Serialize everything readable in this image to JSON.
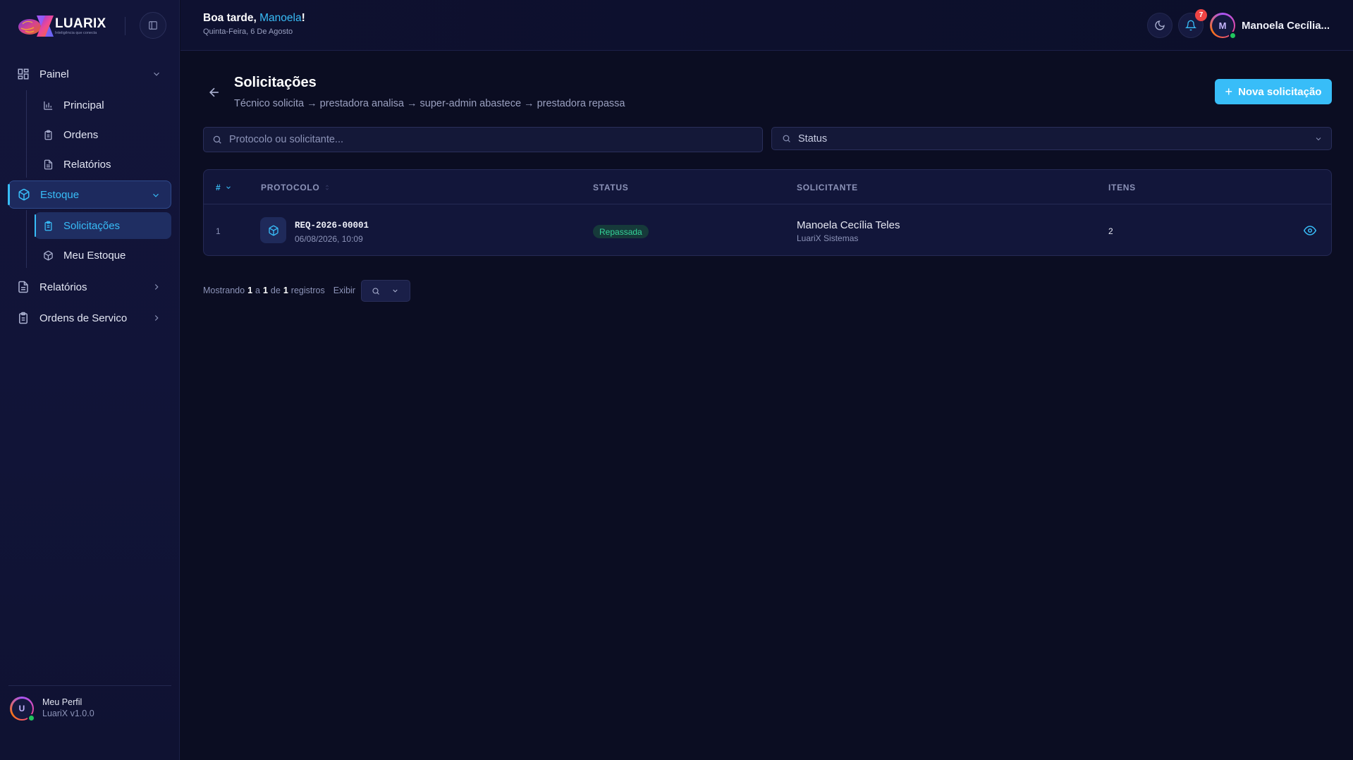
{
  "brand": {
    "name": "LUARIX",
    "tagline": "Inteligência que conecta"
  },
  "sidebar": {
    "items": [
      {
        "label": "Painel",
        "icon": "grid-icon",
        "expanded": true,
        "children": [
          {
            "label": "Principal",
            "icon": "bar-chart-icon"
          },
          {
            "label": "Ordens",
            "icon": "clipboard-icon"
          },
          {
            "label": "Relatórios",
            "icon": "file-text-icon"
          }
        ]
      },
      {
        "label": "Estoque",
        "icon": "package-icon",
        "expanded": true,
        "active": true,
        "children": [
          {
            "label": "Solicitações",
            "icon": "clipboard-list-icon",
            "active": true
          },
          {
            "label": "Meu Estoque",
            "icon": "box-icon"
          }
        ]
      },
      {
        "label": "Relatórios",
        "icon": "file-text-icon"
      },
      {
        "label": "Ordens de Servico",
        "icon": "clipboard-icon"
      }
    ],
    "profile": {
      "initial": "U",
      "name": "Meu Perfil",
      "version": "LuariX v1.0.0"
    }
  },
  "header": {
    "greeting_prefix": "Boa tarde, ",
    "greeting_name": "Manoela",
    "greeting_suffix": "!",
    "date": "Quinta-Feira, 6 De Agosto",
    "notifications_count": "7",
    "user_initial": "M",
    "user_name": "Manoela Cecília..."
  },
  "page": {
    "title": "Solicitações",
    "subtitle": "Técnico solicita → prestadora analisa → super-admin abastece → prestadora repassa",
    "new_button": "Nova solicitação",
    "search_placeholder": "Protocolo ou solicitante...",
    "status_filter": "Status"
  },
  "table": {
    "columns": [
      "#",
      "PROTOCOLO",
      "STATUS",
      "SOLICITANTE",
      "ITENS"
    ],
    "rows": [
      {
        "index": "1",
        "protocol": "REQ-2026-00001",
        "datetime": "06/08/2026, 10:09",
        "status": "Repassada",
        "requester": "Manoela Cecília Teles",
        "organization": "LuariX Sistemas",
        "items": "2"
      }
    ]
  },
  "pagination": {
    "prefix": "Mostrando",
    "from": "1",
    "sep1": "a",
    "to": "1",
    "sep2": "de",
    "total": "1",
    "suffix": "registros",
    "show_label": "Exibir"
  },
  "colors": {
    "accent": "#38bdf8",
    "background": "#0b0d22",
    "success": "#34d399",
    "badge": "#ef4444"
  }
}
